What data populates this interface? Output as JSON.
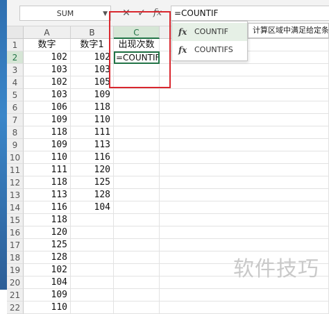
{
  "formula_bar": {
    "name_box": "SUM",
    "cancel_icon": "✕",
    "enter_icon": "✓",
    "fx_icon": "fx",
    "formula": "=COUNTIF"
  },
  "columns": [
    "A",
    "B",
    "C"
  ],
  "rows": [
    {
      "n": "1",
      "a": "数字",
      "b": "数字1",
      "c": "出现次数"
    },
    {
      "n": "2",
      "a": "102",
      "b": "102",
      "c": "=COUNTIF"
    },
    {
      "n": "3",
      "a": "103",
      "b": "103",
      "c": ""
    },
    {
      "n": "4",
      "a": "102",
      "b": "105",
      "c": ""
    },
    {
      "n": "5",
      "a": "103",
      "b": "109",
      "c": ""
    },
    {
      "n": "6",
      "a": "106",
      "b": "118",
      "c": ""
    },
    {
      "n": "7",
      "a": "109",
      "b": "110",
      "c": ""
    },
    {
      "n": "8",
      "a": "118",
      "b": "111",
      "c": ""
    },
    {
      "n": "9",
      "a": "109",
      "b": "113",
      "c": ""
    },
    {
      "n": "10",
      "a": "110",
      "b": "116",
      "c": ""
    },
    {
      "n": "11",
      "a": "111",
      "b": "120",
      "c": ""
    },
    {
      "n": "12",
      "a": "118",
      "b": "125",
      "c": ""
    },
    {
      "n": "13",
      "a": "113",
      "b": "128",
      "c": ""
    },
    {
      "n": "14",
      "a": "116",
      "b": "104",
      "c": ""
    },
    {
      "n": "15",
      "a": "118",
      "b": "",
      "c": ""
    },
    {
      "n": "16",
      "a": "120",
      "b": "",
      "c": ""
    },
    {
      "n": "17",
      "a": "125",
      "b": "",
      "c": ""
    },
    {
      "n": "18",
      "a": "128",
      "b": "",
      "c": ""
    },
    {
      "n": "19",
      "a": "102",
      "b": "",
      "c": ""
    },
    {
      "n": "20",
      "a": "104",
      "b": "",
      "c": ""
    },
    {
      "n": "21",
      "a": "109",
      "b": "",
      "c": ""
    },
    {
      "n": "22",
      "a": "110",
      "b": "",
      "c": ""
    }
  ],
  "autocomplete": {
    "items": [
      {
        "icon": "fx",
        "label": "COUNTIF"
      },
      {
        "icon": "fx",
        "label": "COUNTIFS"
      }
    ],
    "tooltip": "计算区域中满足给定条"
  },
  "watermark": "软件技巧",
  "colors": {
    "accent": "#217346",
    "annotation": "#d9272e"
  }
}
